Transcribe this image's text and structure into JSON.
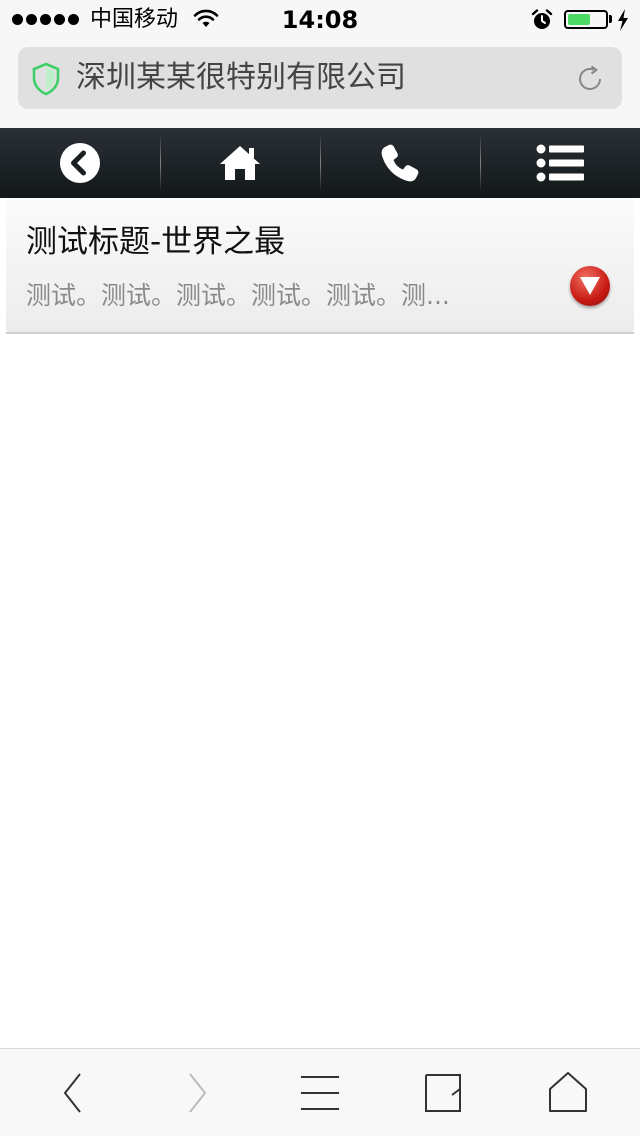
{
  "status_bar": {
    "carrier": "中国移动",
    "time": "14:08",
    "signal_bars": 5,
    "battery_level": 0.6,
    "battery_color": "#4cd964"
  },
  "address_bar": {
    "title": "深圳某某很特别有限公司",
    "security_icon": "shield-icon",
    "reload_icon": "reload-icon",
    "shield_color": "#4cd964"
  },
  "site_toolbar": {
    "items": [
      {
        "icon": "back-circle-icon"
      },
      {
        "icon": "home-icon"
      },
      {
        "icon": "phone-icon"
      },
      {
        "icon": "menu-list-icon"
      }
    ],
    "background": "#1a1f22"
  },
  "content": {
    "item": {
      "title": "测试标题-世界之最",
      "description": "测试。测试。测试。测试。测试。测...",
      "expand_icon": "triangle-down-icon",
      "expand_color": "#c81a14"
    }
  },
  "browser_bar": {
    "items": [
      {
        "icon": "back-chevron-icon"
      },
      {
        "icon": "forward-chevron-icon"
      },
      {
        "icon": "menu-icon"
      },
      {
        "icon": "tabs-icon"
      },
      {
        "icon": "home-outline-icon"
      }
    ]
  }
}
